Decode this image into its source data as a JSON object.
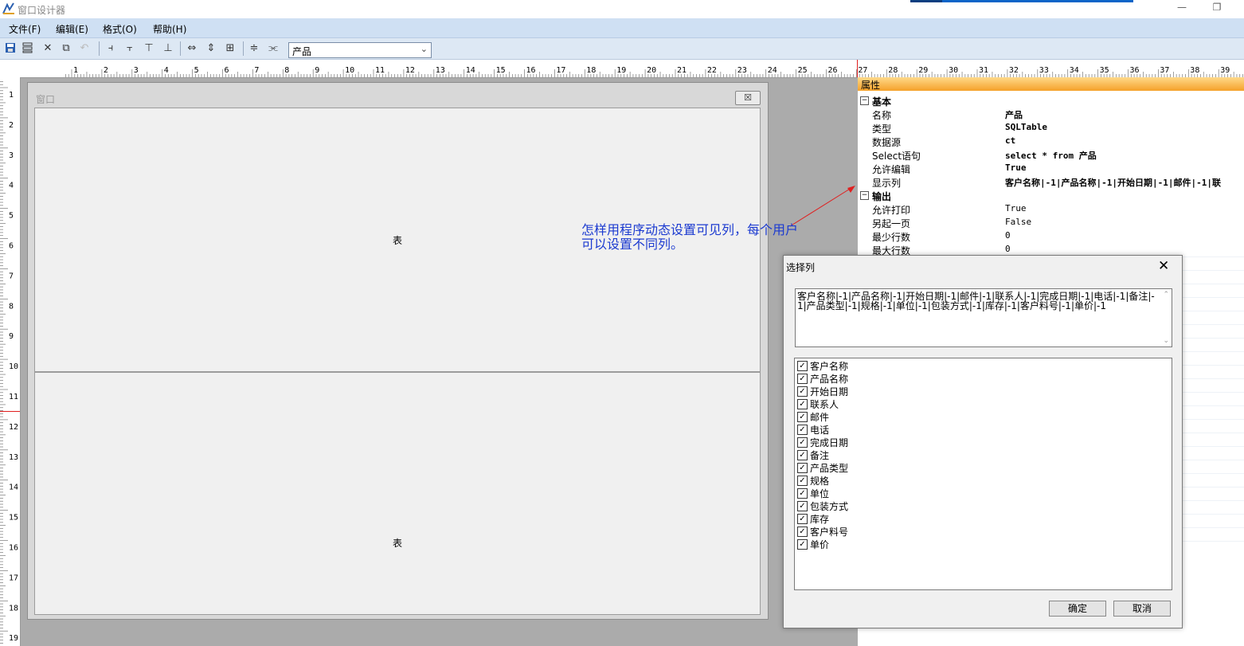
{
  "app": {
    "title": "窗口设计器"
  },
  "menu": [
    "文件(F)",
    "编辑(E)",
    "格式(O)",
    "帮助(H)"
  ],
  "toolbar": {
    "icons": [
      "save-icon",
      "save-all-icon",
      "delete-icon",
      "copy-icon",
      "undo-icon",
      "align-left-icon",
      "align-right-icon",
      "align-top-icon",
      "align-bottom-icon",
      "same-width-icon",
      "same-height-icon",
      "same-size-icon",
      "distribute-vertical-icon",
      "distribute-horizontal-icon"
    ],
    "combo_value": "产品"
  },
  "ruler": {
    "h_numbers": [
      "1",
      "2",
      "3",
      "4",
      "5",
      "6",
      "7",
      "8",
      "9",
      "10",
      "11",
      "12",
      "13",
      "14",
      "15",
      "16",
      "17",
      "18",
      "19",
      "20",
      "21",
      "22",
      "23",
      "24",
      "25",
      "26",
      "27",
      "28",
      "29",
      "30",
      "31",
      "32",
      "33",
      "34",
      "35",
      "36",
      "37",
      "38",
      "39"
    ],
    "v_numbers": [
      "1",
      "2",
      "3",
      "4",
      "5",
      "6",
      "7",
      "8",
      "9",
      "10",
      "11",
      "12",
      "13",
      "14",
      "15",
      "16",
      "17",
      "18",
      "19"
    ]
  },
  "design": {
    "window_caption": "窗口",
    "close_glyph": "☒",
    "table1_label": "表",
    "table2_label": "表"
  },
  "annotation": {
    "line1": "怎样用程序动态设置可见列，每个用户",
    "line2": "可以设置不同列。"
  },
  "properties": {
    "header": "属性",
    "sections": [
      {
        "title": "基本",
        "rows": [
          {
            "name": "名称",
            "value": "产品",
            "bold": true
          },
          {
            "name": "类型",
            "value": "SQLTable",
            "bold": true
          },
          {
            "name": "数据源",
            "value": "ct",
            "bold": true
          },
          {
            "name": "Select语句",
            "value": "select * from 产品",
            "bold": true
          },
          {
            "name": "允许编辑",
            "value": "True",
            "bold": true
          },
          {
            "name": "显示列",
            "value": "客户名称|-1|产品名称|-1|开始日期|-1|邮件|-1|联",
            "bold": true
          }
        ]
      },
      {
        "title": "输出",
        "rows": [
          {
            "name": "允许打印",
            "value": "True",
            "bold": false
          },
          {
            "name": "另起一页",
            "value": "False",
            "bold": false
          },
          {
            "name": "最少行数",
            "value": "0",
            "bold": false
          },
          {
            "name": "最大行数",
            "value": "0",
            "bold": false
          }
        ]
      }
    ]
  },
  "dialog": {
    "title": "选择列",
    "text": "客户名称|-1|产品名称|-1|开始日期|-1|邮件|-1|联系人|-1|完成日期|-1|电话|-1|备注|-1|产品类型|-1|规格|-1|单位|-1|包装方式|-1|库存|-1|客户料号|-1|单价|-1",
    "columns": [
      "客户名称",
      "产品名称",
      "开始日期",
      "联系人",
      "邮件",
      "电话",
      "完成日期",
      "备注",
      "产品类型",
      "规格",
      "单位",
      "包装方式",
      "库存",
      "客户料号",
      "单价"
    ],
    "ok_label": "确定",
    "cancel_label": "取消",
    "check_glyph": "✓",
    "close_glyph": "✕"
  }
}
